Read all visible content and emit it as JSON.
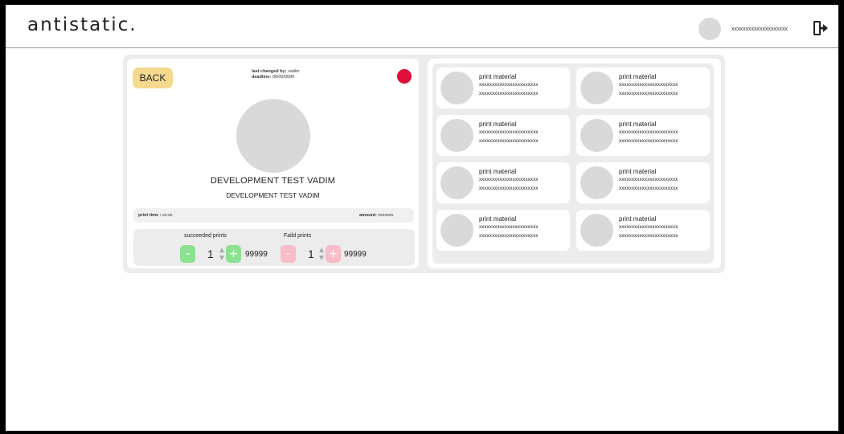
{
  "header": {
    "logo": "antistatic.",
    "username": "xxxxxxxxxxxxxxxxxxxx"
  },
  "detail": {
    "back_label": "BACK",
    "last_changed_label": "last changed by:",
    "last_changed_value": "vadim",
    "deadline_label": "deadline:",
    "deadline_value": "00/00/0000",
    "status_color": "#e0103a",
    "title": "DEVELOPMENT TEST VADIM",
    "subtitle": "DEVELOPMENT TEST VADIM",
    "print_time_label": "print time :",
    "print_time_value": "xx:xx",
    "amount_label": "amount:",
    "amount_value": "xxxxxxx"
  },
  "counters": {
    "succeeded": {
      "label": "succeeded prints",
      "minus": "-",
      "plus": "+",
      "value": "1",
      "max": "99999",
      "color": "#8be18f"
    },
    "failed": {
      "label": "Faild prints",
      "minus": "-",
      "plus": "+",
      "value": "1",
      "max": "99999",
      "color": "#f9bcc9"
    }
  },
  "materials": [
    {
      "name": "print material",
      "line1": "xxxxxxxxxxxxxxxxxxxxxxx",
      "line2": "xxxxxxxxxxxxxxxxxxxxxxx"
    },
    {
      "name": "print material",
      "line1": "xxxxxxxxxxxxxxxxxxxxxxx",
      "line2": "xxxxxxxxxxxxxxxxxxxxxxx"
    },
    {
      "name": "print material",
      "line1": "xxxxxxxxxxxxxxxxxxxxxxx",
      "line2": "xxxxxxxxxxxxxxxxxxxxxxx"
    },
    {
      "name": "print material",
      "line1": "xxxxxxxxxxxxxxxxxxxxxxx",
      "line2": "xxxxxxxxxxxxxxxxxxxxxxx"
    },
    {
      "name": "print material",
      "line1": "xxxxxxxxxxxxxxxxxxxxxxx",
      "line2": "xxxxxxxxxxxxxxxxxxxxxxx"
    },
    {
      "name": "print material",
      "line1": "xxxxxxxxxxxxxxxxxxxxxxx",
      "line2": "xxxxxxxxxxxxxxxxxxxxxxx"
    },
    {
      "name": "print material",
      "line1": "xxxxxxxxxxxxxxxxxxxxxxx",
      "line2": "xxxxxxxxxxxxxxxxxxxxxxx"
    },
    {
      "name": "print material",
      "line1": "xxxxxxxxxxxxxxxxxxxxxxx",
      "line2": "xxxxxxxxxxxxxxxxxxxxxxx"
    }
  ],
  "icons": {
    "logout": "logout-icon"
  }
}
